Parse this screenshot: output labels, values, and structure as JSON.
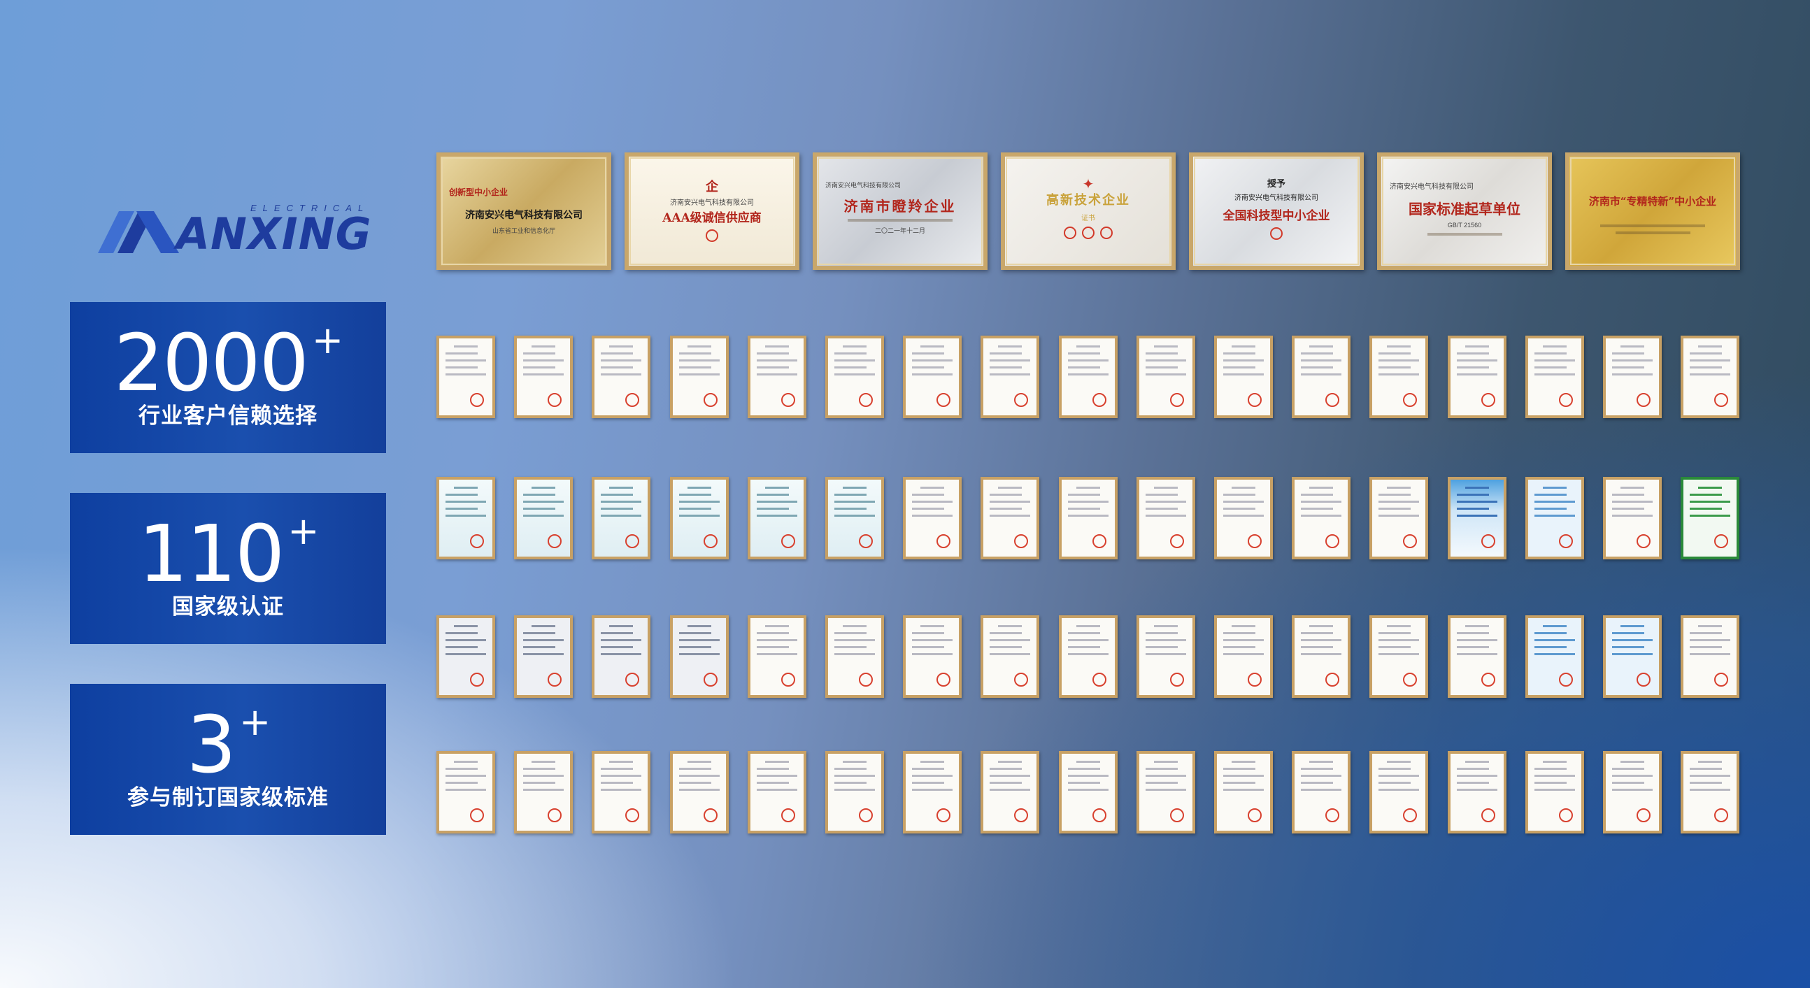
{
  "brand": {
    "name": "ANXING",
    "tagline": "ELECTRICAL",
    "colors": {
      "primary": "#1e3c9e",
      "box": "#1749a8"
    }
  },
  "stats": [
    {
      "number": "2000",
      "suffix": "+",
      "label": "行业客户信赖选择"
    },
    {
      "number": "110",
      "suffix": "+",
      "label": "国家级认证"
    },
    {
      "number": "3",
      "suffix": "+",
      "label": "参与制订国家级标准"
    }
  ],
  "plaques": [
    {
      "top": "创新型中小企业",
      "main": "济南安兴电气科技有限公司",
      "bottom": "山东省工业和信息化厅"
    },
    {
      "top": "济南安兴电气科技有限公司",
      "main": "AAA级诚信供应商",
      "bottom": ""
    },
    {
      "top": "济南安兴电气科技有限公司",
      "main": "济南市瞪羚企业",
      "bottom": "二〇二一年十二月"
    },
    {
      "top": "",
      "main": "高新技术企业",
      "bottom": "证书"
    },
    {
      "top": "授予",
      "main": "全国科技型中小企业",
      "bottom": "济南安兴电气科技有限公司"
    },
    {
      "top": "济南安兴电气科技有限公司",
      "main": "国家标准起草单位",
      "bottom": "GB/T 21560"
    },
    {
      "top": "",
      "main": "济南市“专精特新”中小企业",
      "bottom": ""
    }
  ],
  "certificate_rows": [
    {
      "count": 17,
      "style": "plain"
    },
    {
      "count": 17,
      "style": "mixed"
    },
    {
      "count": 17,
      "style": "report"
    },
    {
      "count": 17,
      "style": "patent"
    }
  ]
}
